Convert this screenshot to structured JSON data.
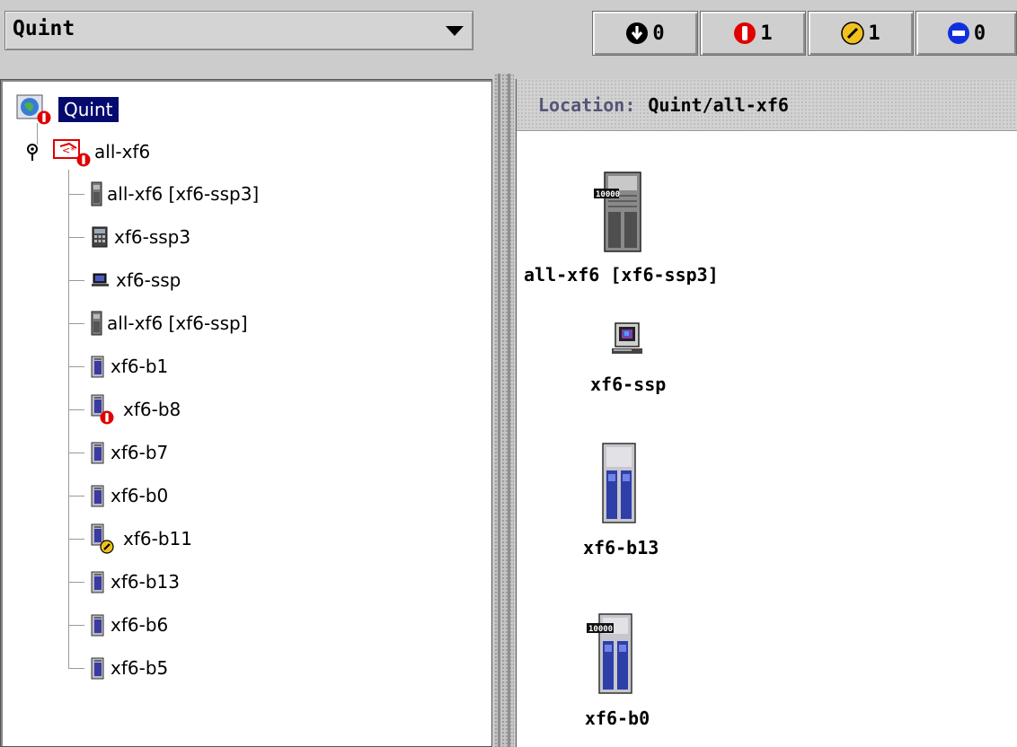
{
  "domain_selector": {
    "value": "Quint"
  },
  "alarm_counts": [
    {
      "icon": "down-alarm-icon",
      "color": "#000000",
      "count": "0"
    },
    {
      "icon": "critical-alarm-icon",
      "color": "#e00000",
      "count": "1"
    },
    {
      "icon": "minor-alarm-icon",
      "color": "#f0c020",
      "count": "1"
    },
    {
      "icon": "disabled-alarm-icon",
      "color": "#1030e0",
      "count": "0"
    }
  ],
  "tree": {
    "root": {
      "label": "Quint",
      "icon": "domain-globe-icon",
      "alarm": "critical"
    },
    "group": {
      "label": "all-xf6",
      "icon": "composite-group-icon",
      "alarm": "critical"
    },
    "children": [
      {
        "label": "all-xf6 [xf6-ssp3]",
        "icon": "server-cabinet-icon"
      },
      {
        "label": "xf6-ssp3",
        "icon": "calculator-host-icon"
      },
      {
        "label": "xf6-ssp",
        "icon": "workstation-icon"
      },
      {
        "label": "all-xf6 [xf6-ssp]",
        "icon": "server-cabinet-icon"
      },
      {
        "label": "xf6-b1",
        "icon": "server-icon"
      },
      {
        "label": "xf6-b8",
        "icon": "server-icon",
        "alarm": "critical"
      },
      {
        "label": "xf6-b7",
        "icon": "server-icon"
      },
      {
        "label": "xf6-b0",
        "icon": "server-icon"
      },
      {
        "label": "xf6-b11",
        "icon": "server-icon",
        "alarm": "minor"
      },
      {
        "label": "xf6-b13",
        "icon": "server-icon"
      },
      {
        "label": "xf6-b6",
        "icon": "server-icon"
      },
      {
        "label": "xf6-b5",
        "icon": "server-icon"
      }
    ]
  },
  "location": {
    "label": "Location:",
    "value": "Quint/all-xf6"
  },
  "view_objects": [
    {
      "label": "all-xf6 [xf6-ssp3]",
      "icon": "enterprise-10000-icon"
    },
    {
      "label": "xf6-ssp",
      "icon": "workstation-icon"
    },
    {
      "label": "xf6-b13",
      "icon": "blade-server-icon"
    },
    {
      "label": "xf6-b0",
      "icon": "enterprise-10000-blade-icon"
    }
  ]
}
